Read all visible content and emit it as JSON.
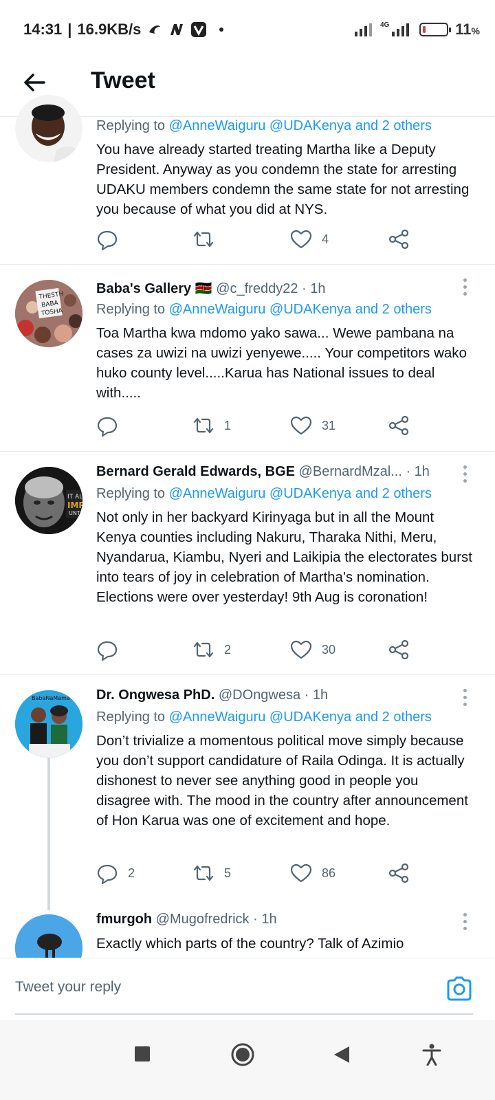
{
  "status_bar": {
    "time": "14:31",
    "speed": "16.9KB/s",
    "network": "4G",
    "battery": "11",
    "battery_unit": "%",
    "battery_level": 0.11
  },
  "header": {
    "title": "Tweet"
  },
  "tweets": [
    {
      "name": "",
      "handle": "",
      "time": "",
      "replying_label": "Replying to",
      "replying_mentions": "@AnneWaiguru @UDAKenya and 2 others",
      "text": "You have already started treating Martha like a Deputy President.  Anyway as you condemn the state for arresting UDAKU members condemn the same state for not arresting you because of what you did at NYS.",
      "replies": "",
      "retweets": "",
      "likes": "4"
    },
    {
      "name": "Baba's Gallery 🇰🇪",
      "handle": "@c_freddy22",
      "time": "· 1h",
      "replying_label": "Replying to",
      "replying_mentions": "@AnneWaiguru @UDAKenya and 2 others",
      "text": "Toa Martha kwa mdomo yako sawa... Wewe pambana na cases za uwizi na uwizi yenyewe..... Your competitors wako huko county level.....Karua has National issues to deal with.....",
      "replies": "",
      "retweets": "1",
      "likes": "31"
    },
    {
      "name": "Bernard Gerald Edwards, BGE",
      "handle": "@BernardMzal...",
      "time": "· 1h",
      "replying_label": "Replying to",
      "replying_mentions": "@AnneWaiguru @UDAKenya and 2 others",
      "text": "Not only in her backyard Kirinyaga but in all the Mount Kenya counties including Nakuru, Tharaka Nithi, Meru, Nyandarua, Kiambu, Nyeri and Laikipia the electorates burst into tears of joy in celebration of Martha's nomination. Elections were over yesterday! 9th Aug is coronation!",
      "replies": "",
      "retweets": "2",
      "likes": "30"
    },
    {
      "name": "Dr. Ongwesa PhD.",
      "handle": "@DOngwesa",
      "time": "· 1h",
      "replying_label": "Replying to",
      "replying_mentions": "@AnneWaiguru @UDAKenya and 2 others",
      "text": "Don’t trivialize a momentous political move simply because you don’t support candidature of Raila Odinga. It is actually dishonest to never see anything good in people you disagree with. The mood in the country after announcement of Hon Karua was one of excitement and hope.",
      "replies": "2",
      "retweets": "5",
      "likes": "86"
    },
    {
      "name": "fmurgoh",
      "handle": "@Mugofredrick",
      "time": "· 1h",
      "text": "Exactly which parts of the country? Talk of Azimio"
    }
  ],
  "reply_box": {
    "placeholder": "Tweet your reply"
  },
  "colors": {
    "accent": "#1d9bf0",
    "muted": "#536471"
  },
  "icons": [
    "back-arrow-icon",
    "reply-icon",
    "retweet-icon",
    "like-icon",
    "share-icon",
    "more-icon",
    "camera-icon",
    "square-nav-icon",
    "home-circle-nav-icon",
    "back-triangle-nav-icon",
    "accessibility-icon"
  ]
}
